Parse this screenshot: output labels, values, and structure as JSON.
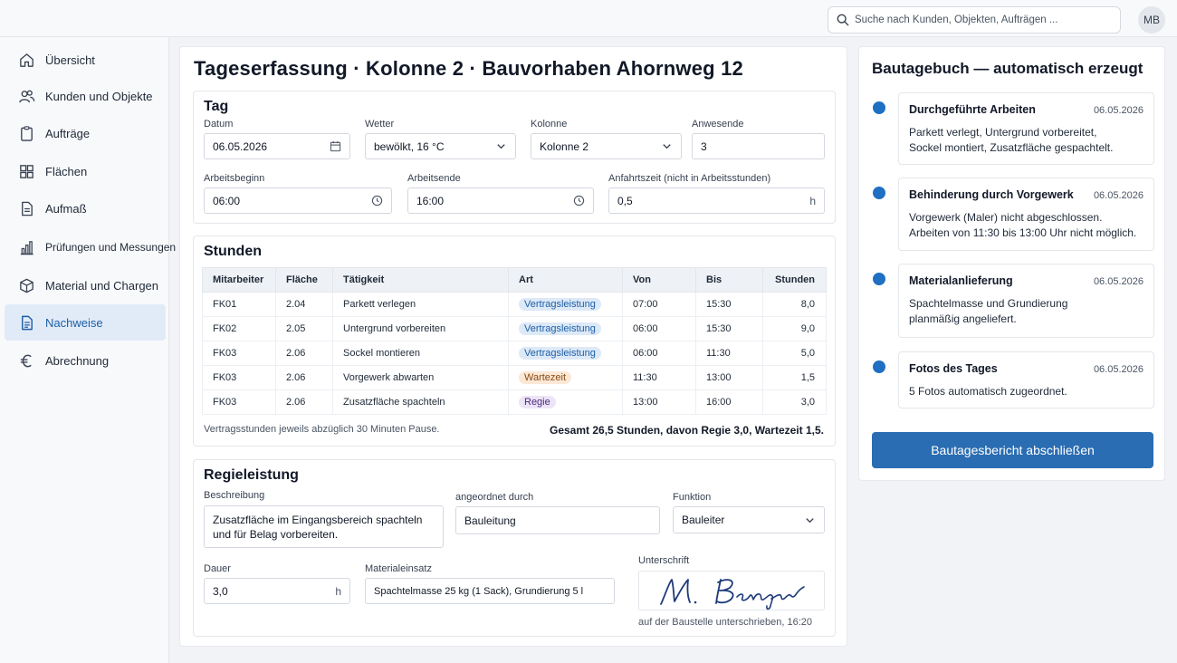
{
  "topbar": {
    "search_placeholder": "Suche nach Kunden, Objekten, Aufträgen ...",
    "avatar_initials": "MB"
  },
  "sidebar": {
    "items": [
      {
        "label": "Übersicht",
        "icon": "home-icon"
      },
      {
        "label": "Kunden und Objekte",
        "icon": "users-icon"
      },
      {
        "label": "Aufträge",
        "icon": "clipboard-icon"
      },
      {
        "label": "Flächen",
        "icon": "grid-icon"
      },
      {
        "label": "Aufmaß",
        "icon": "document-icon"
      },
      {
        "label": "Prüfungen und Messungen",
        "icon": "bar-chart-icon"
      },
      {
        "label": "Material und Chargen",
        "icon": "box-icon"
      },
      {
        "label": "Nachweise",
        "icon": "file-icon",
        "active": true
      },
      {
        "label": "Abrechnung",
        "icon": "euro-icon"
      }
    ]
  },
  "main": {
    "title": "Tageserfassung · Kolonne 2 · Bauvorhaben Ahornweg 12",
    "tag": {
      "heading": "Tag",
      "datum_label": "Datum",
      "datum_value": "06.05.2026",
      "wetter_label": "Wetter",
      "wetter_value": "bewölkt, 16 °C",
      "kolonne_label": "Kolonne",
      "kolonne_value": "Kolonne 2",
      "anwesende_label": "Anwesende",
      "anwesende_value": "3",
      "beginn_label": "Arbeitsbeginn",
      "beginn_value": "06:00",
      "ende_label": "Arbeitsende",
      "ende_value": "16:00",
      "anfahrt_label": "Anfahrtszeit (nicht in Arbeitsstunden)",
      "anfahrt_value": "0,5",
      "anfahrt_unit": "h"
    },
    "stunden": {
      "heading": "Stunden",
      "columns": [
        "Mitarbeiter",
        "Fläche",
        "Tätigkeit",
        "Art",
        "Von",
        "Bis",
        "Stunden"
      ],
      "rows": [
        {
          "mitarbeiter": "FK01",
          "flaeche": "2.04",
          "taetigkeit": "Parkett verlegen",
          "art": "Vertragsleistung",
          "art_type": "vertrag",
          "von": "07:00",
          "bis": "15:30",
          "stunden": "8,0"
        },
        {
          "mitarbeiter": "FK02",
          "flaeche": "2.05",
          "taetigkeit": "Untergrund vorbereiten",
          "art": "Vertragsleistung",
          "art_type": "vertrag",
          "von": "06:00",
          "bis": "15:30",
          "stunden": "9,0"
        },
        {
          "mitarbeiter": "FK03",
          "flaeche": "2.06",
          "taetigkeit": "Sockel montieren",
          "art": "Vertragsleistung",
          "art_type": "vertrag",
          "von": "06:00",
          "bis": "11:30",
          "stunden": "5,0"
        },
        {
          "mitarbeiter": "FK03",
          "flaeche": "2.06",
          "taetigkeit": "Vorgewerk abwarten",
          "art": "Wartezeit",
          "art_type": "warte",
          "von": "11:30",
          "bis": "13:00",
          "stunden": "1,5"
        },
        {
          "mitarbeiter": "FK03",
          "flaeche": "2.06",
          "taetigkeit": "Zusatzfläche spachteln",
          "art": "Regie",
          "art_type": "regie",
          "von": "13:00",
          "bis": "16:00",
          "stunden": "3,0"
        }
      ],
      "note": "Vertragsstunden jeweils abzüglich 30 Minuten Pause.",
      "total": "Gesamt 26,5 Stunden, davon Regie 3,0, Wartezeit 1,5."
    },
    "regie": {
      "heading": "Regieleistung",
      "beschreibung_label": "Beschreibung",
      "beschreibung_value": "Zusatzfläche im Eingangsbereich spachteln\nund für Belag vorbereiten.",
      "angeordnet_label": "angeordnet durch",
      "angeordnet_value": "Bauleitung",
      "funktion_label": "Funktion",
      "funktion_value": "Bauleiter",
      "dauer_label": "Dauer",
      "dauer_value": "3,0",
      "dauer_unit": "h",
      "material_label": "Materialeinsatz",
      "material_value": "Spachtelmasse 25 kg (1 Sack), Grundierung 5 l",
      "unterschrift_label": "Unterschrift",
      "signature": "M. Berger",
      "unterschrift_note": "auf der Baustelle unterschrieben, 16:20"
    }
  },
  "bautagebuch": {
    "title": "Bautagebuch — automatisch erzeugt",
    "entries": [
      {
        "title": "Durchgeführte Arbeiten",
        "date": "06.05.2026",
        "text": "Parkett verlegt, Untergrund vorbereitet,\nSockel montiert, Zusatzfläche gespachtelt."
      },
      {
        "title": "Behinderung durch Vorgewerk",
        "date": "06.05.2026",
        "text": "Vorgewerk (Maler) nicht abgeschlossen.\nArbeiten von 11:30 bis 13:00 Uhr nicht möglich."
      },
      {
        "title": "Materialanlieferung",
        "date": "06.05.2026",
        "text": "Spachtelmasse und Grundierung\nplanmäßig angeliefert."
      },
      {
        "title": "Fotos des Tages",
        "date": "06.05.2026",
        "text": "5 Fotos automatisch zugeordnet."
      }
    ],
    "button_label": "Bautagesbericht abschließen"
  },
  "colors": {
    "accent": "#2a6db2",
    "active_nav_bg": "#e1ebf7",
    "timeline_dot": "#1f6fc2"
  }
}
